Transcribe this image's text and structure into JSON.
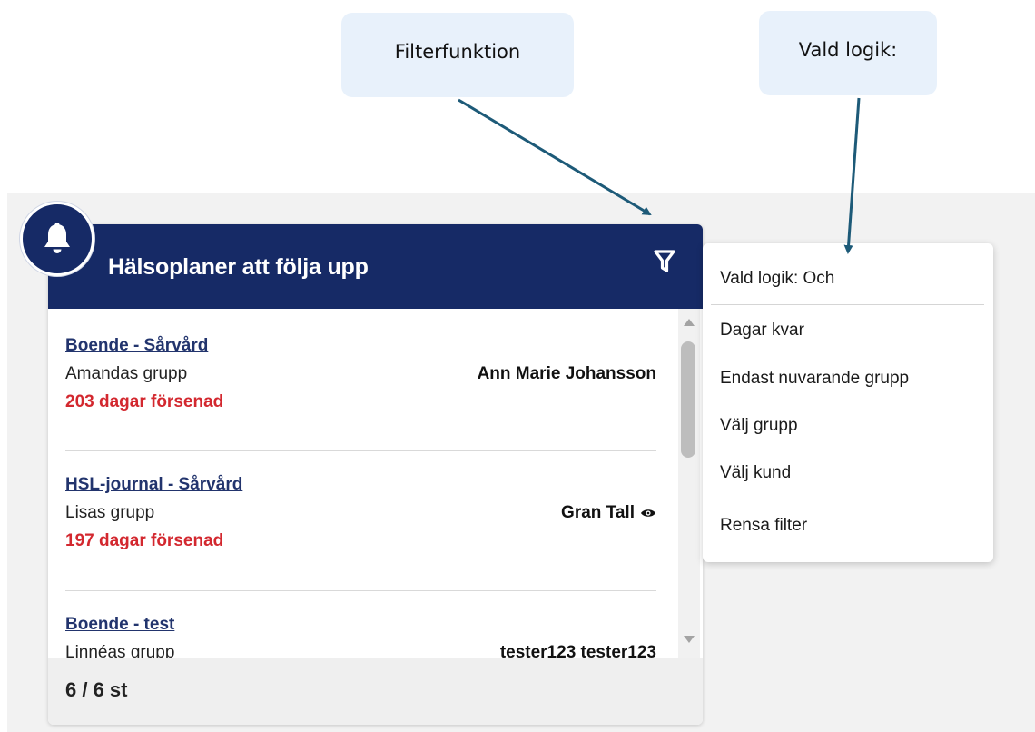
{
  "callouts": {
    "filter": "Filterfunktion",
    "logic": "Vald logik:"
  },
  "widget": {
    "title": "Hälsoplaner att följa upp",
    "footer_count": "6 / 6 st",
    "items": [
      {
        "title": "Boende - Sårvård",
        "group": "Amandas grupp",
        "person": "Ann Marie Johansson",
        "overdue": "203 dagar försenad",
        "has_eye_icon": false
      },
      {
        "title": "HSL-journal - Sårvård",
        "group": "Lisas grupp",
        "person": "Gran Tall",
        "overdue": "197 dagar försenad",
        "has_eye_icon": true
      },
      {
        "title": "Boende - test",
        "group": "Linnéas grupp",
        "person": "tester123 tester123",
        "overdue": "",
        "has_eye_icon": false
      }
    ]
  },
  "filter_menu": {
    "logic_label": "Vald logik: Och",
    "options": [
      "Dagar kvar",
      "Endast nuvarande grupp",
      "Välj grupp",
      "Välj kund"
    ],
    "clear": "Rensa filter"
  },
  "colors": {
    "header_bg": "#162a66",
    "link": "#22346d",
    "overdue": "#d3282f",
    "callout_bg": "#e8f1fb",
    "arrow": "#1d5a78",
    "page_bg": "#f2f2f2"
  },
  "icons": {
    "badge": "bell-icon",
    "filter": "funnel-icon",
    "watched": "eye-icon"
  }
}
